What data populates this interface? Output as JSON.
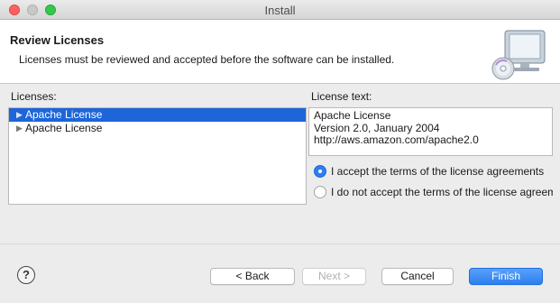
{
  "window": {
    "title": "Install"
  },
  "header": {
    "title": "Review Licenses",
    "description": "Licenses must be reviewed and accepted before the software can be installed.",
    "icon": "computer-cd-icon"
  },
  "licenses": {
    "label": "Licenses:",
    "items": [
      {
        "label": "Apache License",
        "selected": true
      },
      {
        "label": "Apache License",
        "selected": false
      }
    ]
  },
  "license_text": {
    "label": "License text:",
    "content": "Apache License\nVersion 2.0, January 2004\nhttp://aws.amazon.com/apache2.0"
  },
  "options": {
    "accept": {
      "label": "I accept the terms of the license agreements",
      "checked": true
    },
    "decline": {
      "label": "I do not accept the terms of the license agreements",
      "checked": false
    }
  },
  "footer": {
    "help": "?",
    "back": "< Back",
    "next": "Next >",
    "cancel": "Cancel",
    "finish": "Finish"
  },
  "colors": {
    "selection": "#1d65d9",
    "primary_button": "#2c7ff0"
  }
}
